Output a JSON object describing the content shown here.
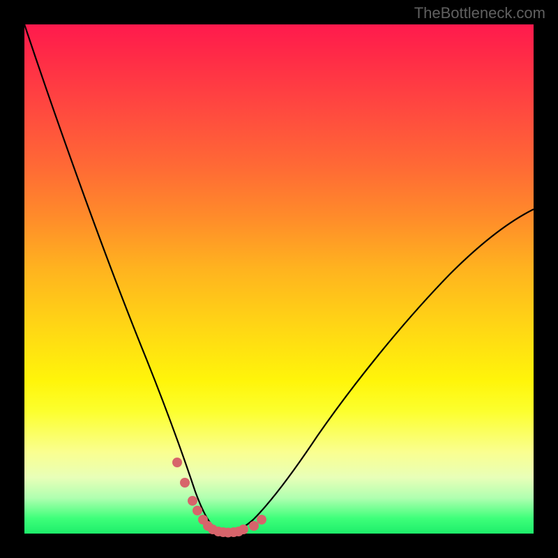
{
  "watermark": "TheBottleneck.com",
  "chart_data": {
    "type": "line",
    "title": "",
    "xlabel": "",
    "ylabel": "",
    "xlim": [
      0,
      100
    ],
    "ylim": [
      0,
      100
    ],
    "grid": false,
    "legend": false,
    "note": "Axes unlabeled; values estimated from pixel positions within 730x730 plot area (0-100 normalized).",
    "series": [
      {
        "name": "curve",
        "color": "#000000",
        "x": [
          0,
          3,
          6,
          9,
          12,
          15,
          18,
          21,
          24,
          26,
          28,
          30,
          31.5,
          33,
          34.5,
          36,
          38,
          40,
          42,
          45,
          48,
          52,
          56,
          60,
          65,
          70,
          75,
          80,
          85,
          90,
          95,
          100
        ],
        "y": [
          100,
          89,
          79,
          69.5,
          61,
          53,
          45.5,
          38,
          31,
          25,
          19.5,
          14,
          10,
          6.5,
          3.5,
          1.5,
          0.5,
          0.2,
          0.4,
          1.5,
          4,
          8,
          13,
          18,
          24,
          30,
          36,
          42,
          47.5,
          53,
          58,
          63
        ]
      },
      {
        "name": "highlight-dots",
        "color": "#d7646b",
        "type": "scatter",
        "x": [
          30,
          31.5,
          33,
          34,
          35,
          36,
          37,
          38,
          39,
          40,
          41,
          42,
          43,
          45,
          46.5
        ],
        "y": [
          14,
          10,
          6.5,
          4.5,
          2.8,
          1.5,
          0.8,
          0.5,
          0.3,
          0.2,
          0.3,
          0.4,
          0.8,
          1.5,
          2.8
        ]
      }
    ],
    "background_gradient": {
      "top": "#ff1a4d",
      "mid": "#fff50a",
      "bottom": "#1dee6a"
    }
  }
}
